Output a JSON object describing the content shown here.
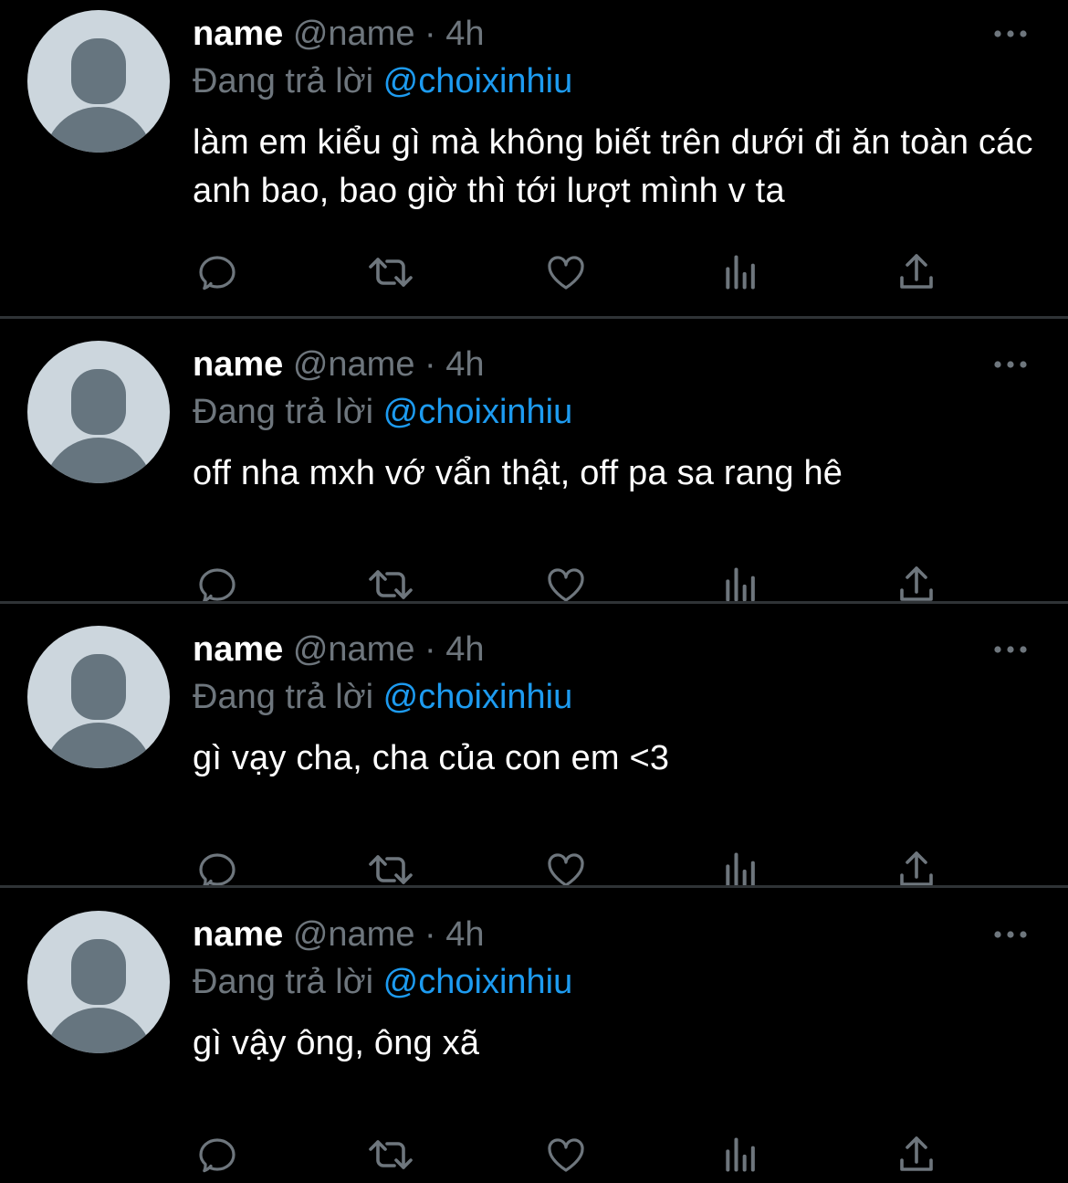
{
  "tweets": [
    {
      "display_name": "name",
      "handle": "@name",
      "separator": "·",
      "time": "4h",
      "reply_prefix": "Đang trả lời",
      "reply_to": "@choixinhiu",
      "text": "làm em kiểu gì mà không biết trên dưới đi ăn toàn các anh bao, bao giờ thì tới lượt mình v ta"
    },
    {
      "display_name": "name",
      "handle": "@name",
      "separator": "·",
      "time": "4h",
      "reply_prefix": "Đang trả lời",
      "reply_to": "@choixinhiu",
      "text": "off nha mxh vớ vẩn thật, off pa sa rang hê"
    },
    {
      "display_name": "name",
      "handle": "@name",
      "separator": "·",
      "time": "4h",
      "reply_prefix": "Đang trả lời",
      "reply_to": "@choixinhiu",
      "text": "gì vạy cha, cha của con em <3"
    },
    {
      "display_name": "name",
      "handle": "@name",
      "separator": "·",
      "time": "4h",
      "reply_prefix": "Đang trả lời",
      "reply_to": "@choixinhiu",
      "text": "gì vậy ông, ông xã"
    }
  ],
  "actions": [
    "reply-icon",
    "retweet-icon",
    "like-icon",
    "analytics-icon",
    "share-icon"
  ],
  "more_icon": "more-horizontal-icon",
  "colors": {
    "background": "#000000",
    "primary_text": "#ffffff",
    "secondary_text": "#6e767d",
    "accent": "#1d9bf0",
    "divider": "#2f3336",
    "avatar_bg": "#ccd6dd",
    "avatar_fg": "#66757f"
  }
}
